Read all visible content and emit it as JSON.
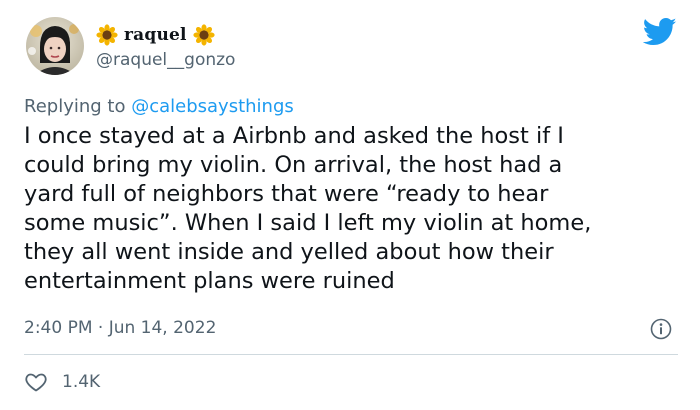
{
  "author": {
    "display_name": "raquel",
    "handle": "@raquel__gonzo",
    "name_emoji": "sunflower-icon"
  },
  "reply": {
    "prefix": "Replying to",
    "mention": "@calebsaysthings"
  },
  "tweet": {
    "text": "I once stayed at a Airbnb and asked the host if I\ncould bring my violin. On arrival, the host had a\nyard full of neighbors that were “ready to hear\nsome music”. When I said I left my violin at home,\nthey all went inside and yelled about how their\nentertainment plans were ruined",
    "timestamp": "2:40 PM · Jun 14, 2022"
  },
  "engagement": {
    "likes": "1.4K"
  },
  "colors": {
    "brand": "#1d9bf0",
    "text": "#0f1419",
    "secondary": "#536471",
    "divider": "#cfd9de"
  },
  "icons": {
    "logo": "twitter-bird-icon",
    "info": "info-icon",
    "like": "heart-icon"
  }
}
